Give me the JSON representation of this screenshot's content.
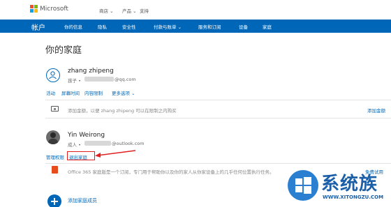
{
  "top": {
    "brand": "Microsoft",
    "links": [
      "商店 ⌄",
      "产品 ⌄",
      "支持"
    ]
  },
  "nav": {
    "title": "帐户",
    "items": [
      "你的信息",
      "隐私",
      "安全性",
      "付款与账单 ⌄",
      "服务和订阅",
      "设备",
      "家庭"
    ]
  },
  "page_title": "你的家庭",
  "member1": {
    "name": "zhang zhipeng",
    "role": "孩子 •",
    "email_suffix": "@qq.com",
    "actions": [
      "活动",
      "屏幕时间",
      "内容限制",
      "更多选项 ⌄"
    ]
  },
  "money_row": {
    "text": "添加金额，以便 zhang zhipeng 可以在限制之内购买",
    "link": "添加金额"
  },
  "member2": {
    "name": "Yin Weirong",
    "role": "成人 •",
    "email_suffix": "@outlook.com",
    "actions": [
      "管理权限",
      "退出家庭"
    ]
  },
  "office_row": {
    "text": "Office 365 家庭版是一个订阅，专门用于帮助你以及你的家人从你家设备上的几乎任何位置执行任务。",
    "link": "免费试用"
  },
  "add_member": {
    "label": "添加家庭成员"
  },
  "watermark": {
    "title": "系统族",
    "url": "WWW.XITONGZU.COM"
  },
  "colors": {
    "accent": "#0067b8",
    "annotation": "#e02020"
  }
}
